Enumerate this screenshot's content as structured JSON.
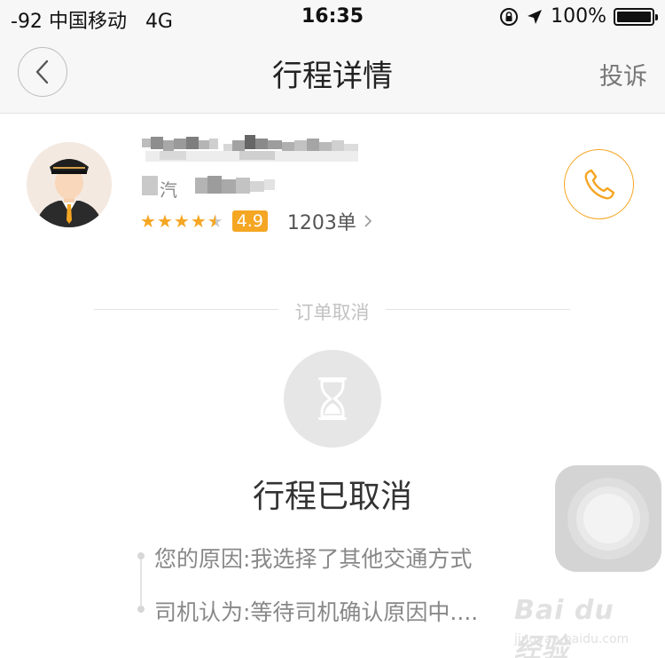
{
  "status_bar": {
    "signal": "-92",
    "carrier": "中国移动",
    "network": "4G",
    "time": "16:35",
    "battery": "100%",
    "battery_level": 1.0
  },
  "nav": {
    "title": "行程详情",
    "action": "投诉",
    "back_icon": "chevron-left-icon"
  },
  "driver": {
    "car_partial": "汽",
    "rating_stars": 4.5,
    "score": "4.9",
    "orders": "1203单",
    "call_icon": "phone-icon"
  },
  "section_label": "订单取消",
  "status": {
    "icon": "hourglass-icon",
    "title": "行程已取消"
  },
  "reasons": [
    {
      "text": "您的原因:我选择了其他交通方式"
    },
    {
      "text": "司机认为:等待司机确认原因中...."
    }
  ],
  "watermark": {
    "brand": "Bai du 经验",
    "url": "jingyan.baidu.com"
  },
  "colors": {
    "accent": "#f5a623",
    "text_primary": "#333333",
    "text_secondary": "#888888",
    "nav_bg": "#f7f7f7"
  }
}
